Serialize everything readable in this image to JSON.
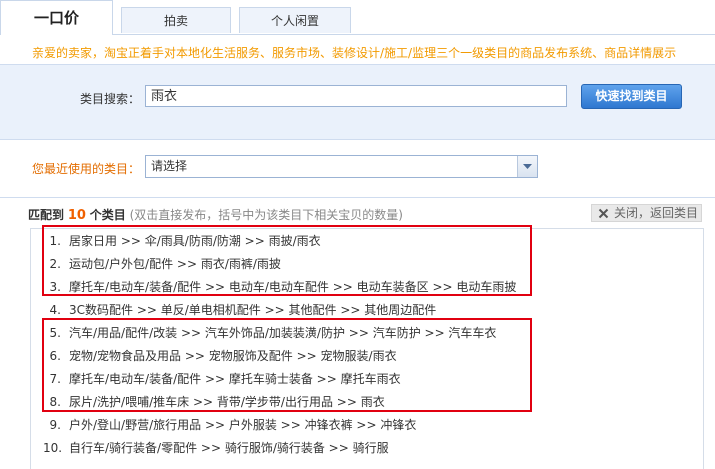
{
  "tabs": [
    {
      "label": "一口价"
    },
    {
      "label": "拍卖"
    },
    {
      "label": "个人闲置"
    }
  ],
  "notice": "亲爱的卖家，淘宝正着手对本地化生活服务、服务市场、装修设计/施工/监理三个一级类目的商品发布系统、商品详情展示",
  "search": {
    "label": "类目搜索：",
    "value": "雨衣",
    "button": "快速找到类目"
  },
  "recent": {
    "label": "您最近使用的类目：",
    "selected": "请选择"
  },
  "results": {
    "prefix": "匹配到",
    "count": "10",
    "suffix": "个类目",
    "hint": "(双击直接发布，括号中为该类目下相关宝贝的数量)",
    "close": "关闭，返回类目",
    "items": [
      {
        "num": "1.",
        "path": "居家日用 >> 伞/雨具/防雨/防潮 >> 雨披/雨衣"
      },
      {
        "num": "2.",
        "path": "运动包/户外包/配件 >> 雨衣/雨裤/雨披"
      },
      {
        "num": "3.",
        "path": "摩托车/电动车/装备/配件 >> 电动车/电动车配件 >> 电动车装备区 >> 电动车雨披"
      },
      {
        "num": "4.",
        "path": "3C数码配件 >> 单反/单电相机配件 >> 其他配件 >> 其他周边配件"
      },
      {
        "num": "5.",
        "path": "汽车/用品/配件/改装 >> 汽车外饰品/加装装潢/防护 >> 汽车防护 >> 汽车车衣"
      },
      {
        "num": "6.",
        "path": "宠物/宠物食品及用品 >> 宠物服饰及配件 >> 宠物服装/雨衣"
      },
      {
        "num": "7.",
        "path": "摩托车/电动车/装备/配件 >> 摩托车骑士装备 >> 摩托车雨衣"
      },
      {
        "num": "8.",
        "path": "尿片/洗护/喂哺/推车床 >> 背带/学步带/出行用品 >> 雨衣"
      },
      {
        "num": "9.",
        "path": "户外/登山/野营/旅行用品 >> 户外服装 >> 冲锋衣裤 >> 冲锋衣"
      },
      {
        "num": "10.",
        "path": "自行车/骑行装备/零配件 >> 骑行服饰/骑行装备 >> 骑行服"
      }
    ]
  },
  "colors": {
    "accent_orange": "#f29a00",
    "highlight_red": "#e10010",
    "button_blue": "#2f77d0"
  }
}
